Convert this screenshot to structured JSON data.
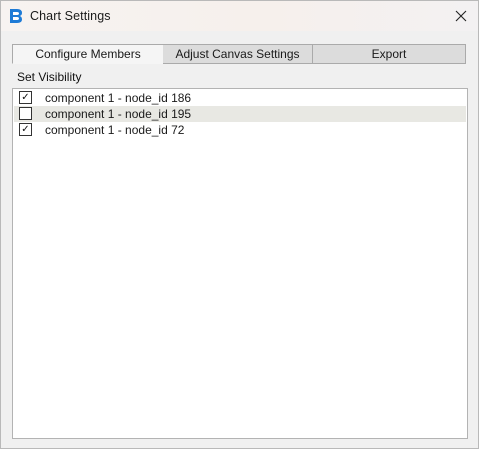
{
  "window": {
    "title": "Chart Settings"
  },
  "icons": {
    "app": "app-logo-icon",
    "close": "close-icon"
  },
  "tabs": [
    {
      "label": "Configure Members",
      "active": true
    },
    {
      "label": "Adjust Canvas Settings",
      "active": false
    },
    {
      "label": "Export",
      "active": false
    }
  ],
  "visibility": {
    "label": "Set Visibility",
    "items": [
      {
        "label": "component 1 - node_id 186",
        "checked": true,
        "check_glyph": "✓"
      },
      {
        "label": "component 1 - node_id 195",
        "checked": false,
        "check_glyph": ""
      },
      {
        "label": "component 1 - node_id 72",
        "checked": true,
        "check_glyph": "✓"
      }
    ]
  },
  "colors": {
    "accent": "#1e7bd6",
    "alt_row": "#e8e8e3"
  }
}
